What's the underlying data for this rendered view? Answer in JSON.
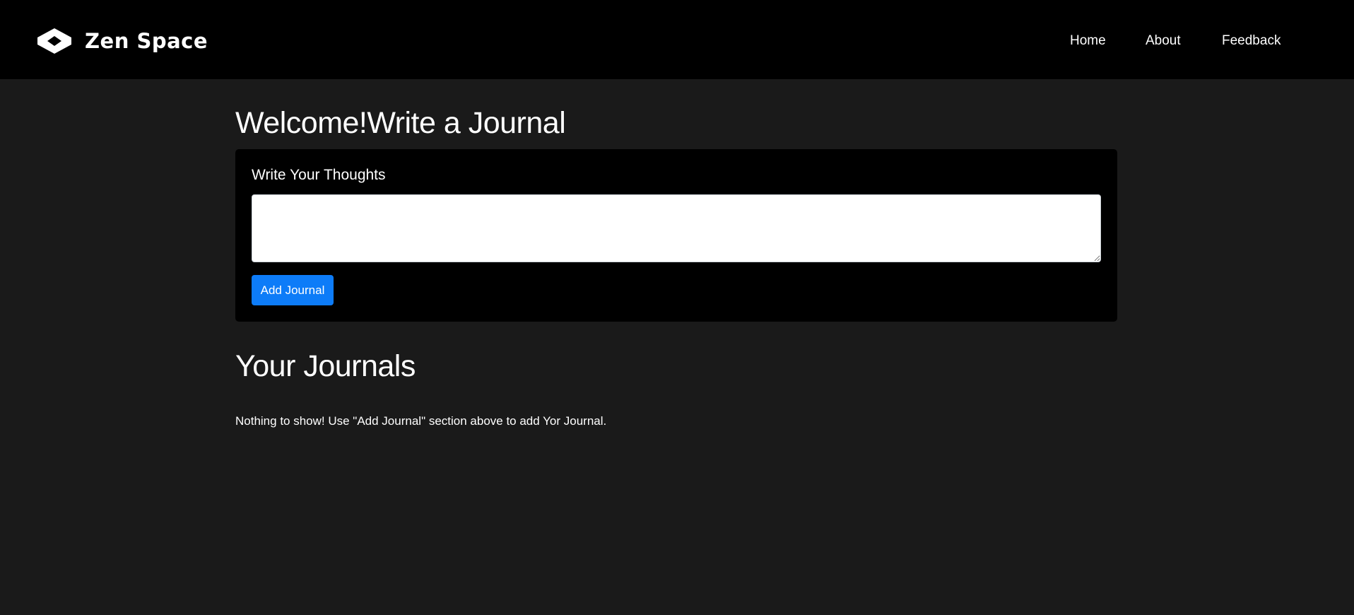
{
  "navbar": {
    "brand": {
      "name": "Zen Space",
      "logo_icon": "zen-space-logo-icon"
    },
    "links": [
      {
        "label": "Home"
      },
      {
        "label": "About"
      },
      {
        "label": "Feedback"
      }
    ],
    "background_color": "#000000"
  },
  "main": {
    "title": "Welcome!Write a Journal",
    "form": {
      "label": "Write Your Thoughts",
      "textarea_value": "",
      "submit_label": "Add Journal",
      "button_color": "#0d7cf8"
    },
    "journals_section": {
      "title": "Your Journals",
      "empty_message": "Nothing to show! Use \"Add Journal\" section above to add Yor Journal."
    }
  },
  "colors": {
    "page_background": "#1a1a1a",
    "card_background": "#000000",
    "text": "#ffffff"
  }
}
